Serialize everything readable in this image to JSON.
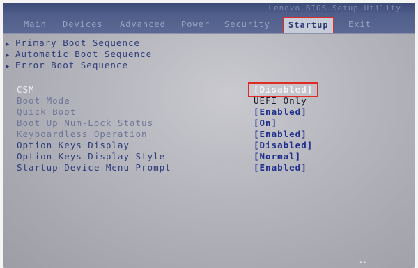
{
  "header": {
    "product_title": "Lenovo BIOS Setup Utility"
  },
  "menu": {
    "tabs": [
      {
        "label": "Main"
      },
      {
        "label": "Devices"
      },
      {
        "label": "Advanced"
      },
      {
        "label": "Power"
      },
      {
        "label": "Security"
      },
      {
        "label": "Startup"
      },
      {
        "label": "Exit"
      }
    ],
    "active_tab": "Startup"
  },
  "sequences": [
    {
      "label": "Primary Boot Sequence",
      "icon": "triangle-right-icon"
    },
    {
      "label": "Automatic Boot Sequence",
      "icon": "triangle-right-icon"
    },
    {
      "label": "Error Boot Sequence",
      "icon": "triangle-right-icon"
    }
  ],
  "options": [
    {
      "label": "CSM",
      "value": "[Disabled]"
    },
    {
      "label": "Boot Mode",
      "value": "UEFI Only"
    },
    {
      "label": "Quick Boot",
      "value": "[Enabled]"
    },
    {
      "label": "Boot Up Num-Lock Status",
      "value": "[On]"
    },
    {
      "label": "Keyboardless Operation",
      "value": "[Enabled]"
    },
    {
      "label": "Option Keys Display",
      "value": "[Disabled]"
    },
    {
      "label": "Option Keys Display Style",
      "value": "[Normal]"
    },
    {
      "label": "Startup Device Menu Prompt",
      "value": "[Enabled]"
    }
  ],
  "colors": {
    "highlight_border": "#e02a26",
    "screen_background": "#b4b4bc",
    "menu_bar": "#4e5d89",
    "text_blue": "#2e3b7a"
  }
}
